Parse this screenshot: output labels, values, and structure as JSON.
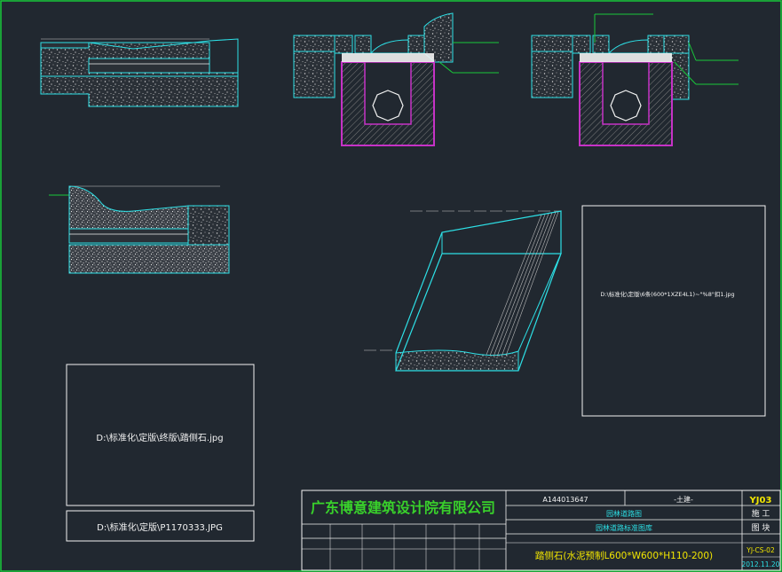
{
  "image_refs": {
    "left_top": "D:\\标准化\\定版\\终版\\踏侧石.jpg",
    "left_bottom": "D:\\标准化\\定版\\P1170333.JPG",
    "right": "D:\\标准化\\定版\\6条(600*1XZE4L1)~\"%8\"扣1.jpg"
  },
  "title_block": {
    "company": "广东博意建筑设计院有限公司",
    "drawing_no": "A144013647",
    "discipline": "-土建-",
    "code": "YJ03",
    "stage": "施 工",
    "sheet_type": "图 块",
    "category": "园林道路图",
    "subcategory": "园林道路标准图库",
    "sheet_title": "踏侧石(水泥预制L600*W600*H110-200)",
    "ref_no": "YJ-CS-02",
    "date": "2012.11.20"
  },
  "colors": {
    "background": "#212830",
    "frame": "#19c93a",
    "cyan": "#2de0e6",
    "magenta": "#c632c6",
    "white": "#f2f2f2",
    "yellow": "#f2e600",
    "green_text": "#39d12b"
  }
}
